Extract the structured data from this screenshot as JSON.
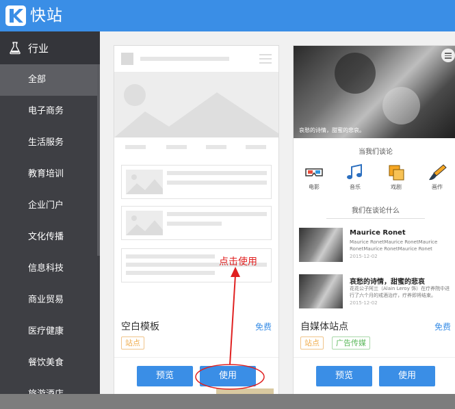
{
  "app": {
    "title": "快站"
  },
  "sidebar": {
    "heading": "行业",
    "items": [
      {
        "label": "全部",
        "active": true
      },
      {
        "label": "电子商务"
      },
      {
        "label": "生活服务"
      },
      {
        "label": "教育培训"
      },
      {
        "label": "企业门户"
      },
      {
        "label": "文化传播"
      },
      {
        "label": "信息科技"
      },
      {
        "label": "商业贸易"
      },
      {
        "label": "医疗健康"
      },
      {
        "label": "餐饮美食"
      },
      {
        "label": "旅游酒店"
      }
    ]
  },
  "cards": [
    {
      "name": "空白模板",
      "price": "免费",
      "tags": [
        "站点"
      ],
      "preview_label": "预览",
      "use_label": "使用"
    },
    {
      "name": "自媒体站点",
      "price": "免费",
      "tags": [
        "站点",
        "广告传媒"
      ],
      "preview_label": "预览",
      "use_label": "使用",
      "preview": {
        "caption": "哀愁的诗情，甜蜜的悲哀。",
        "section1": "当我们谈论",
        "features": [
          "电影",
          "音乐",
          "戏剧",
          "画作"
        ],
        "section2": "我们在谈论什么",
        "articles": [
          {
            "title": "Maurice Ronet",
            "text": "Maurice RonetMaurice RonetMaurice RonetMaurice RonetMaurice Ronet",
            "date": "2015-12-02"
          },
          {
            "title": "哀愁的诗情，甜蜜的悲哀",
            "text": "花花公子阿兰（Alain Leroy 饰）在疗养院中进行了六个月的戒酒治疗，疗养即将结束。",
            "date": "2015-12-02"
          }
        ]
      }
    }
  ],
  "annotation": {
    "text": "点击使用"
  },
  "colors": {
    "accent": "#3a8ee6",
    "annotation": "#e02020",
    "tag_orange": "#f0ad4e",
    "tag_green": "#5cb85c"
  }
}
